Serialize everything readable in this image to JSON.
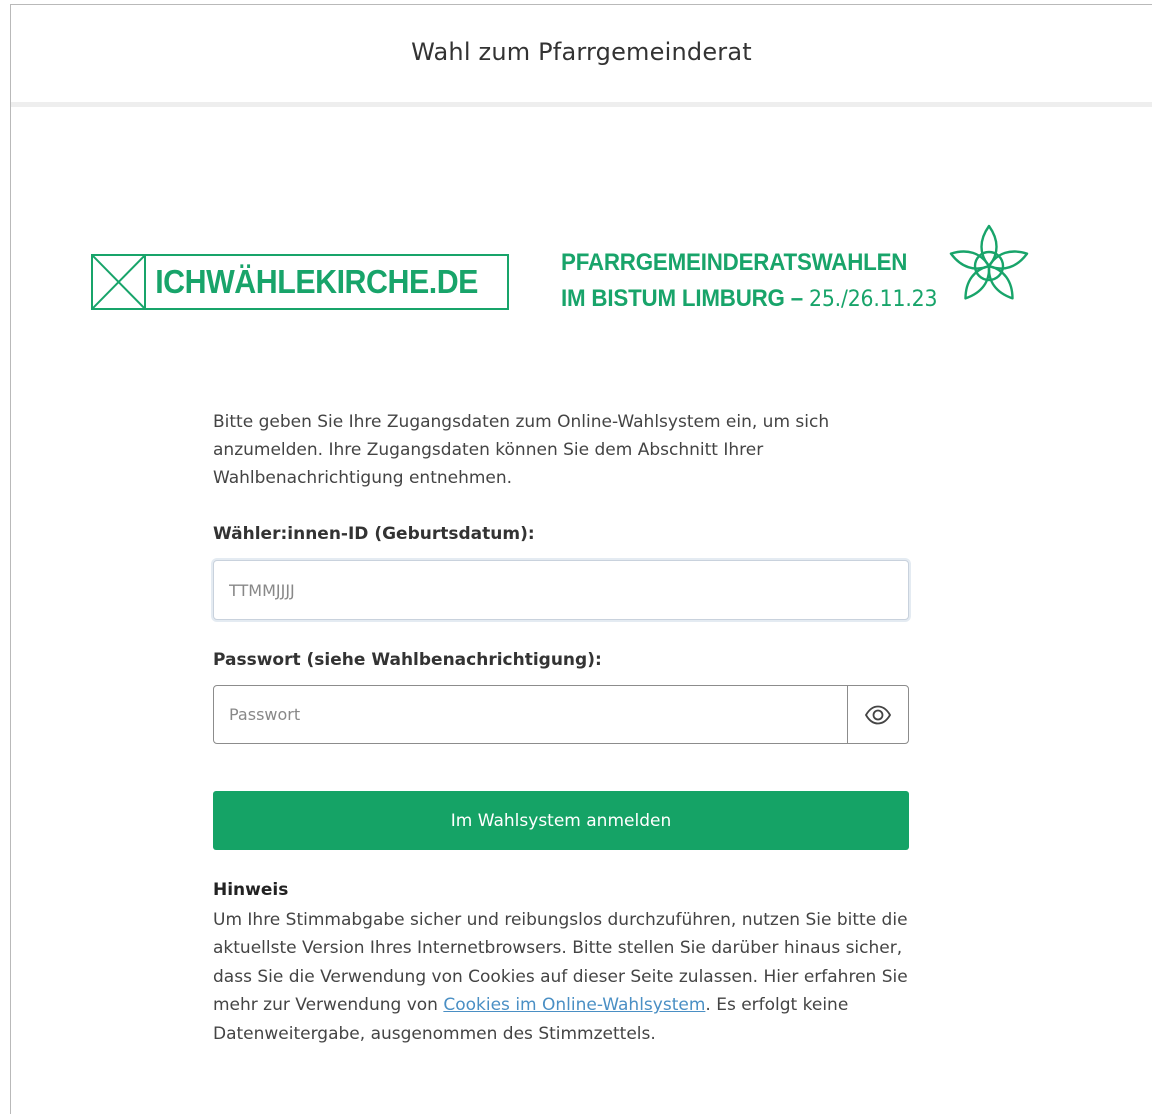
{
  "header": {
    "title": "Wahl zum Pfarrgemeinderat"
  },
  "logos": {
    "campaign_text": "ICHWÄHLEKIRCHE.DE",
    "election_line1": "PFARRGEMEINDERATSWAHLEN",
    "election_line2_main": "IM BISTUM LIMBURG – ",
    "election_line2_date": "25./26.11.23"
  },
  "form": {
    "intro": "Bitte geben Sie Ihre Zugangsdaten zum Online-Wahlsystem ein, um sich anzumelden. Ihre Zugangsdaten können Sie dem Abschnitt Ihrer Wahlbenachrichtigung entnehmen.",
    "voter_id_label": "Wähler:innen-ID (Geburtsdatum):",
    "voter_id_placeholder": "TTMMJJJJ",
    "voter_id_value": "",
    "password_label": "Passwort (siehe Wahlbenachrichtigung):",
    "password_placeholder": "Passwort",
    "password_value": "",
    "submit_label": "Im Wahlsystem anmelden"
  },
  "notice": {
    "title": "Hinweis",
    "text_before_link": "Um Ihre Stimmabgabe sicher und reibungslos durchzuführen, nutzen Sie bitte die aktuellste Version Ihres Internetbrowsers. Bitte stellen Sie darüber hinaus sicher, dass Sie die Verwendung von Cookies auf dieser Seite zulassen. Hier erfahren Sie mehr zur Verwendung von ",
    "link_text": "Cookies im Online-Wahlsystem",
    "text_after_link": ". Es erfolgt keine Datenweitergabe, ausgenommen des Stimmzettels."
  },
  "colors": {
    "brand_green": "#18a46a",
    "button_green": "#15a366",
    "link_blue": "#4a8fc4"
  },
  "icons": {
    "logo_box": "cross-box-icon",
    "emblem": "star-knot-emblem-icon",
    "show_password": "eye-icon"
  }
}
